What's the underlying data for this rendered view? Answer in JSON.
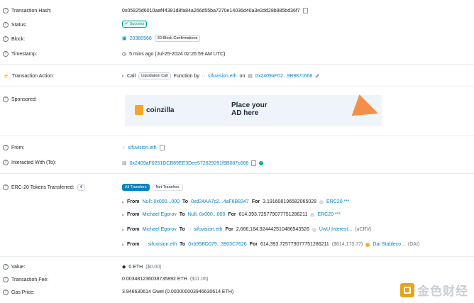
{
  "tx_hash": {
    "label": "Transaction Hash:",
    "value": "0x05825d6010aaf44381d8fa84a266d55ba7270e14036d40a3e2dd28b985bd36f7"
  },
  "status": {
    "label": "Status:",
    "value": "Success"
  },
  "block": {
    "label": "Block:",
    "value": "20380568",
    "confirmations": "30 Block Confirmations"
  },
  "timestamp": {
    "label": "Timestamp:",
    "value": "5 mins ago (Jul-25-2024 02:26:59 AM UTC)"
  },
  "action": {
    "label": "Transaction Action:",
    "call": "Call",
    "method": "Liquidation Call",
    "function_by": "Function by",
    "by_name": "sifuvision.eth",
    "on": "on",
    "contract": "0x2409aF02...9B987c668"
  },
  "sponsored": {
    "label": "Sponsored:",
    "brand": "coinzilla",
    "line1": "Place your",
    "line2": "AD here"
  },
  "from": {
    "label": "From:",
    "value": "sifuvision.eth"
  },
  "interacted": {
    "label": "Interacted With (To):",
    "value": "0x2409aF0251DCB89EE3Dee572629291f9B087c668"
  },
  "erc20": {
    "label": "ERC-20 Tokens Transferred:",
    "count": "4",
    "tab_all": "All Transfers",
    "tab_net": "Net Transfers",
    "transfers": [
      {
        "from_lbl": "From",
        "from": "Null: 0x000...000",
        "to_lbl": "To",
        "to": "0xd24AA7c2...4aF6B8347",
        "for_lbl": "For",
        "amount": "3.191608196582065028",
        "token": "ERC20 ***",
        "extra": ""
      },
      {
        "from_lbl": "From",
        "from": "Michael Egorov",
        "to_lbl": "To",
        "to": "Null: 0x000...000",
        "for_lbl": "For",
        "amount": "614,393.725779077751286211",
        "token": "ERC20 ***",
        "extra": ""
      },
      {
        "from_lbl": "From",
        "from": "Michael Egorov",
        "to_lbl": "To",
        "to": "sifuvision.eth",
        "for_lbl": "For",
        "amount": "2,666,184.924442510486543526",
        "token": "UwU Interest...",
        "extra": "(uCRV)"
      },
      {
        "from_lbl": "From",
        "from": "sifuvision.eth",
        "to_lbl": "To",
        "to": "0xb95BD079...3903C7626",
        "for_lbl": "For",
        "amount": "614,393.725779077751286211",
        "usd": "($614,173.77)",
        "token": "Dai Stableco...",
        "extra": "(DAI)"
      }
    ]
  },
  "value": {
    "label": "Value:",
    "value": "0 ETH",
    "usd": "($0.00)"
  },
  "fee": {
    "label": "Transaction Fee:",
    "value": "0.003481236038735892 ETH",
    "usd": "($11.06)"
  },
  "gas": {
    "label": "Gas Price:",
    "value": "3.946630614 Gwei (0.000000003946630614 ETH)"
  },
  "watermark": {
    "text": "金色财经"
  },
  "colors": {
    "link": "#0784c3",
    "success": "#00a186",
    "muted": "#6c757d"
  }
}
